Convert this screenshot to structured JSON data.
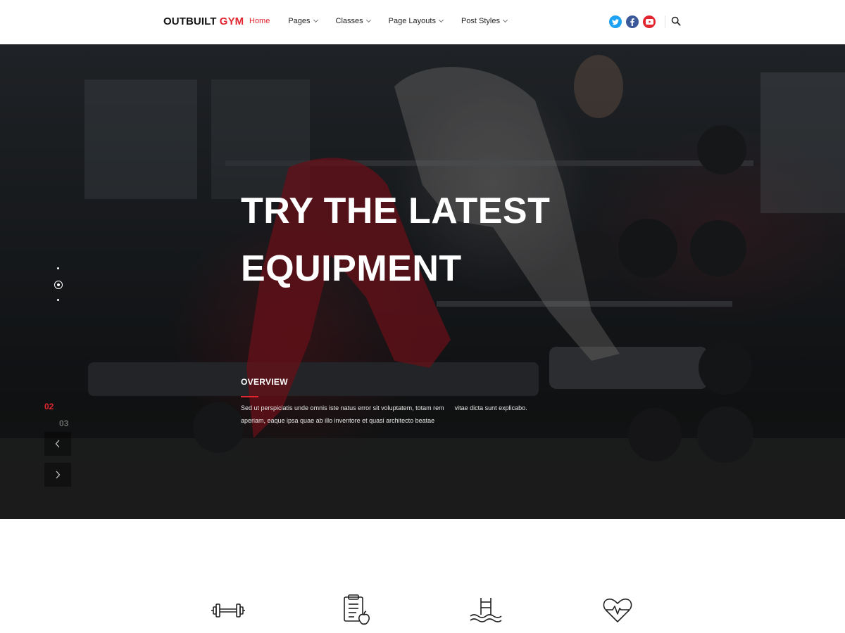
{
  "brand": {
    "name": "OUTBUILT",
    "accent": "GYM",
    "accent_color": "#e2252f"
  },
  "nav": {
    "items": [
      {
        "label": "Home",
        "active": true,
        "dropdown": false
      },
      {
        "label": "Pages",
        "active": false,
        "dropdown": true
      },
      {
        "label": "Classes",
        "active": false,
        "dropdown": true
      },
      {
        "label": "Page Layouts",
        "active": false,
        "dropdown": true
      },
      {
        "label": "Post Styles",
        "active": false,
        "dropdown": true
      }
    ]
  },
  "social": [
    {
      "icon": "twitter-icon",
      "color": "#1da1f2"
    },
    {
      "icon": "facebook-icon",
      "color": "#3b5998"
    },
    {
      "icon": "youtube-icon",
      "color": "#e2252f"
    }
  ],
  "search": {
    "icon": "search-icon"
  },
  "hero": {
    "title_line1": "TRY THE LATEST",
    "title_line2": "EQUIPMENT",
    "overview_label": "OVERVIEW",
    "overview_line1": "Sed ut perspiciatis unde omnis iste natus error sit voluptatem, totam rem      vitae dicta sunt explicabo.",
    "overview_line2": "aperiam, eaque ipsa quae ab illo inventore et quasi architecto beatae",
    "counter_current": "02",
    "counter_next": "03",
    "active_slide_index": 1
  },
  "features": {
    "icons": [
      "dumbbell-icon",
      "nutrition-clipboard-icon",
      "pool-ladder-icon",
      "heartbeat-icon"
    ]
  }
}
